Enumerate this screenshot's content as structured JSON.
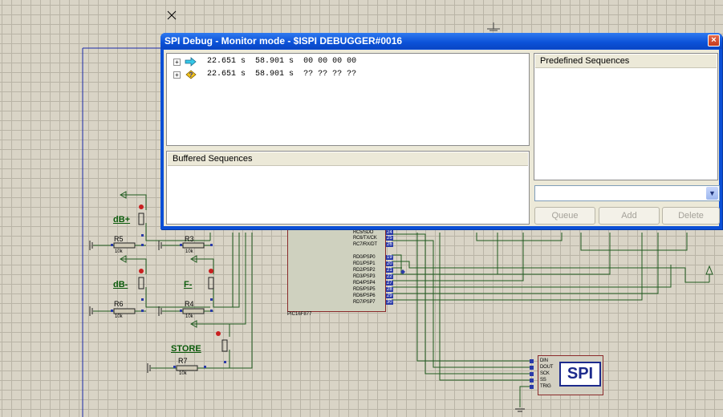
{
  "window": {
    "title": "SPI Debug - Monitor mode - $ISPI DEBUGGER#0016",
    "close_label": "×"
  },
  "log": {
    "rows": [
      {
        "icon": "right-arrow-icon",
        "expander": "+",
        "time1": "22.651 s",
        "time2": "58.901 s",
        "data": "00 00 00 00"
      },
      {
        "icon": "question-icon",
        "expander": "+",
        "time1": "22.651 s",
        "time2": "58.901 s",
        "data": "?? ?? ?? ??"
      }
    ]
  },
  "panels": {
    "buffered": "Buffered Sequences",
    "predefined": "Predefined Sequences"
  },
  "combo": {
    "value": ""
  },
  "buttons": {
    "queue": "Queue",
    "add": "Add",
    "delete": "Delete"
  },
  "schematic": {
    "button_labels": {
      "db_plus": "dB+",
      "db_minus": "dB-",
      "f_minus": "F-",
      "store": "STORE"
    },
    "resistors": [
      {
        "name": "R5",
        "value": "10k"
      },
      {
        "name": "R3",
        "value": "10k"
      },
      {
        "name": "R6",
        "value": "10k"
      },
      {
        "name": "R4",
        "value": "10k"
      },
      {
        "name": "R7",
        "value": "10k"
      }
    ],
    "mcu": {
      "name": "PIC16F877",
      "pins": [
        {
          "label": "RC5/SDO",
          "num": "24"
        },
        {
          "label": "RC6/TX/CK",
          "num": "25"
        },
        {
          "label": "RC7/RX/DT",
          "num": "26"
        },
        {
          "label": "RD0/PSP0",
          "num": "19"
        },
        {
          "label": "RD1/PSP1",
          "num": "20"
        },
        {
          "label": "RD2/PSP2",
          "num": "21"
        },
        {
          "label": "RD3/PSP3",
          "num": "22"
        },
        {
          "label": "RD4/PSP4",
          "num": "27"
        },
        {
          "label": "RD5/PSP5",
          "num": "28"
        },
        {
          "label": "RD6/PSP6",
          "num": "29"
        },
        {
          "label": "RD7/PSP7",
          "num": "30"
        }
      ]
    },
    "spi_debugger": {
      "label": "SPI",
      "pins": [
        "DIN",
        "DOUT",
        "SCK",
        "SS",
        "TRIG"
      ]
    }
  }
}
